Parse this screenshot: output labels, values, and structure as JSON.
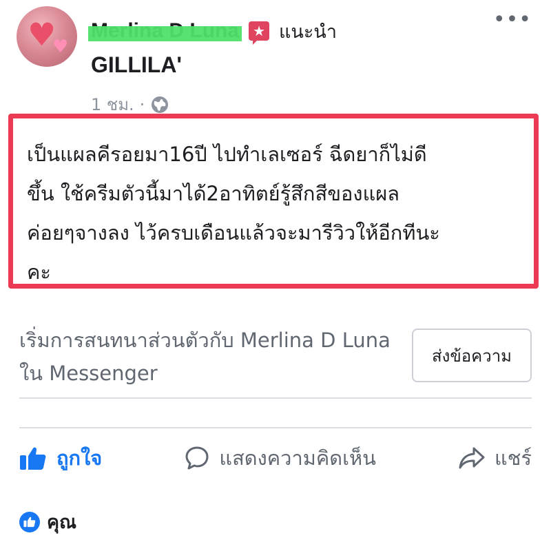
{
  "post": {
    "author_name": "Merlina D Luna",
    "recommend_label": "แนะนำ",
    "page_name": "GILLILA'",
    "timestamp": "1 ชม.",
    "separator": "·",
    "body": "เป็นแผลคีรอยมา16ปี ไปทำเลเซอร์ ฉีดยาก็ไม่ดี\nขึ้น ใช้ครีมตัวนี้มาได้2อาทิตย์รู้สึกสีของแผล\nค่อยๆจางลง ไว้ครบเดือนแล้วจะมารีวิวให้อีกทีนะ\nคะ",
    "highlight_color": "#ec3a55"
  },
  "messenger": {
    "prompt": "เริ่มการสนทนาส่วนตัวกับ Merlina D Luna ใน Messenger",
    "send_label": "ส่งข้อความ"
  },
  "actions": {
    "like_label": "ถูกใจ",
    "comment_label": "แสดงความคิดเห็น",
    "share_label": "แชร์"
  },
  "reactions": {
    "label": "คุณ"
  },
  "icons": {
    "more": "more-options-icon",
    "globe": "globe-icon",
    "star": "star-badge-icon",
    "like": "thumbs-up-icon",
    "comment": "comment-icon",
    "share": "share-icon"
  },
  "colors": {
    "facebook_blue": "#1877f2",
    "secondary_text": "#606770",
    "censor_green": "#4fe06a"
  }
}
